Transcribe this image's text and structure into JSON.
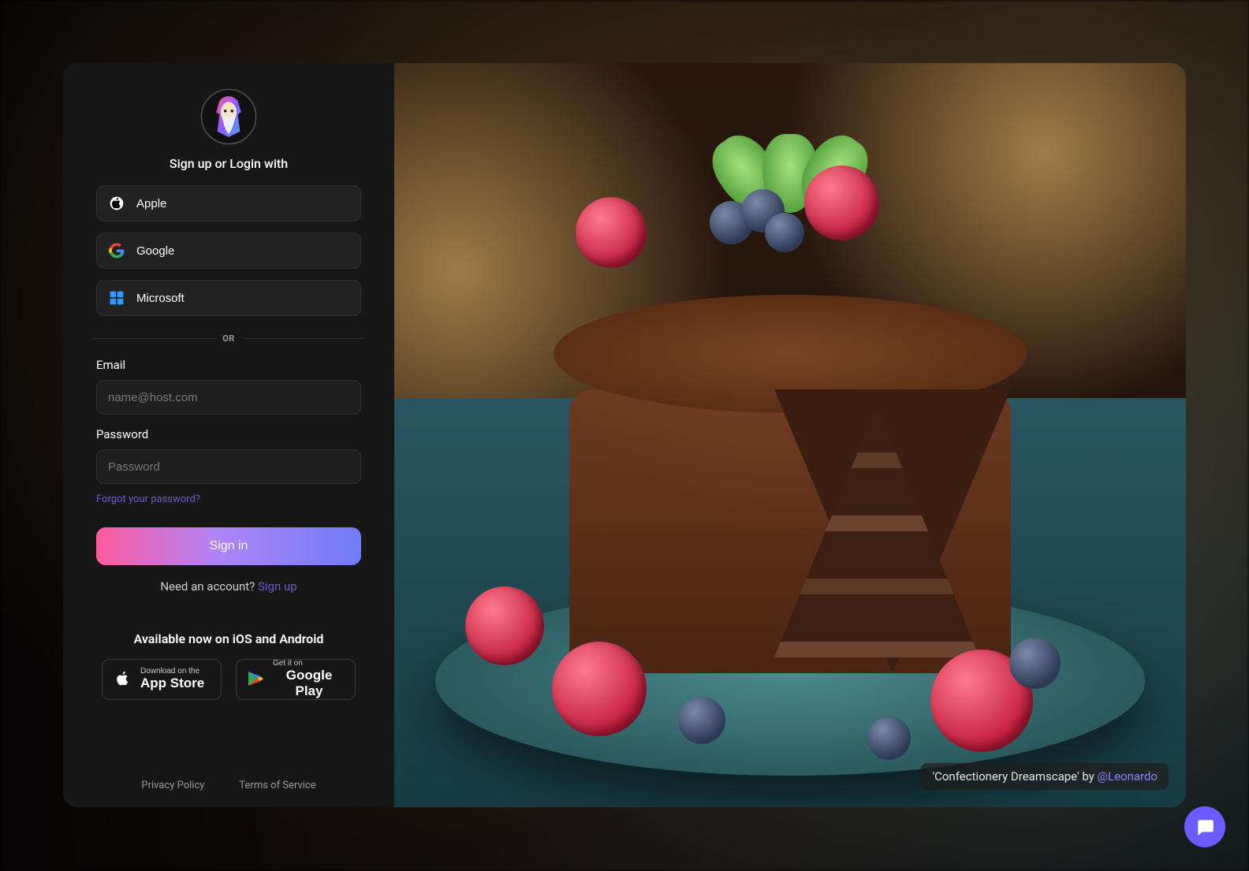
{
  "header": {
    "subtitle": "Sign up or Login with"
  },
  "providers": [
    {
      "id": "apple",
      "label": "Apple"
    },
    {
      "id": "google",
      "label": "Google"
    },
    {
      "id": "microsoft",
      "label": "Microsoft"
    }
  ],
  "divider": {
    "label": "OR"
  },
  "form": {
    "email_label": "Email",
    "email_placeholder": "name@host.com",
    "password_label": "Password",
    "password_placeholder": "Password",
    "forgot_label": "Forgot your password?",
    "signin_label": "Sign in",
    "need_prefix": "Need an account? ",
    "signup_label": "Sign up"
  },
  "apps": {
    "headline": "Available now on iOS and Android",
    "appstore_small": "Download on the",
    "appstore_big": "App Store",
    "play_small": "Get it on",
    "play_big": "Google Play"
  },
  "footer": {
    "privacy": "Privacy Policy",
    "terms": "Terms of Service"
  },
  "artwork": {
    "caption_prefix": "'Confectionery Dreamscape' by ",
    "caption_handle": "@Leonardo"
  }
}
